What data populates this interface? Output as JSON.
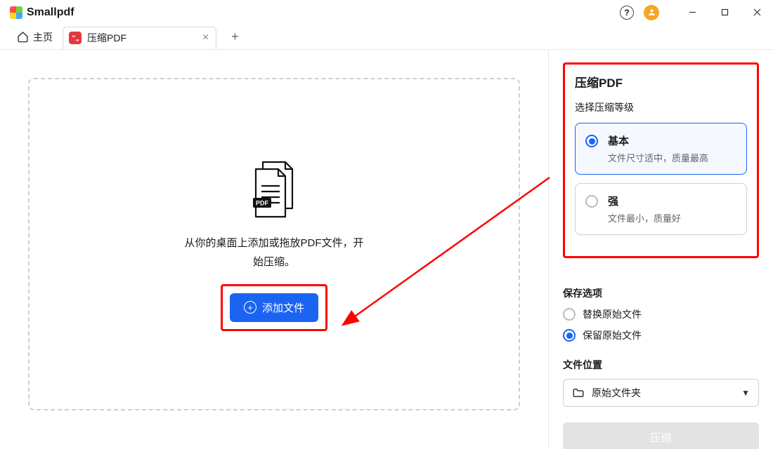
{
  "app": {
    "name": "Smallpdf",
    "help": "?"
  },
  "tabs": {
    "home_label": "主页",
    "active": {
      "label": "压缩PDF"
    }
  },
  "drop": {
    "text_line1": "从你的桌面上添加或拖放PDF文件，开",
    "text_line2": "始压缩。",
    "add_button": "添加文件"
  },
  "side": {
    "panel_title": "压缩PDF",
    "panel_subtitle": "选择压缩等级",
    "opts": [
      {
        "title": "基本",
        "desc": "文件尺寸适中，质量最高"
      },
      {
        "title": "强",
        "desc": "文件最小，质量好"
      }
    ],
    "save_section": "保存选项",
    "save_opts": [
      "替换原始文件",
      "保留原始文件"
    ],
    "location_section": "文件位置",
    "location_value": "原始文件夹",
    "compress_button": "压缩"
  },
  "icons": {
    "pdf_badge": "PDF"
  }
}
